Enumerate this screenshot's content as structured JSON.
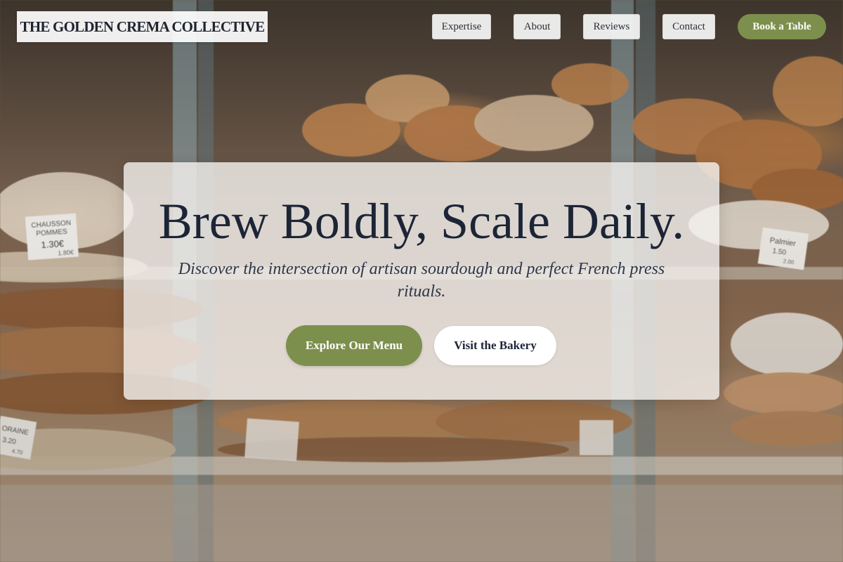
{
  "header": {
    "brand": "THE GOLDEN CREMA COLLECTIVE",
    "nav": [
      {
        "label": "Expertise"
      },
      {
        "label": "About"
      },
      {
        "label": "Reviews"
      },
      {
        "label": "Contact"
      }
    ],
    "cta_label": "Book a Table"
  },
  "hero": {
    "title": "Brew Boldly, Scale Daily.",
    "subtitle": "Discover the intersection of artisan sourdough and perfect French press rituals.",
    "primary_button": "Explore Our Menu",
    "secondary_button": "Visit the Bakery"
  },
  "background": {
    "description_icon": "bakery-display-photo",
    "price_tags": [
      {
        "name": "CHAUSSON POMMES",
        "price": "1.30€",
        "small": "1.80€"
      },
      {
        "name": "Palmier",
        "price": "1.50",
        "small": "2.00"
      },
      {
        "name": "ORAINE",
        "price": "3.20",
        "small": "4.70"
      }
    ]
  },
  "colors": {
    "accent_green": "#7d8f4c",
    "title_navy": "#1c2536",
    "card_bg": "#f5f3f0"
  }
}
